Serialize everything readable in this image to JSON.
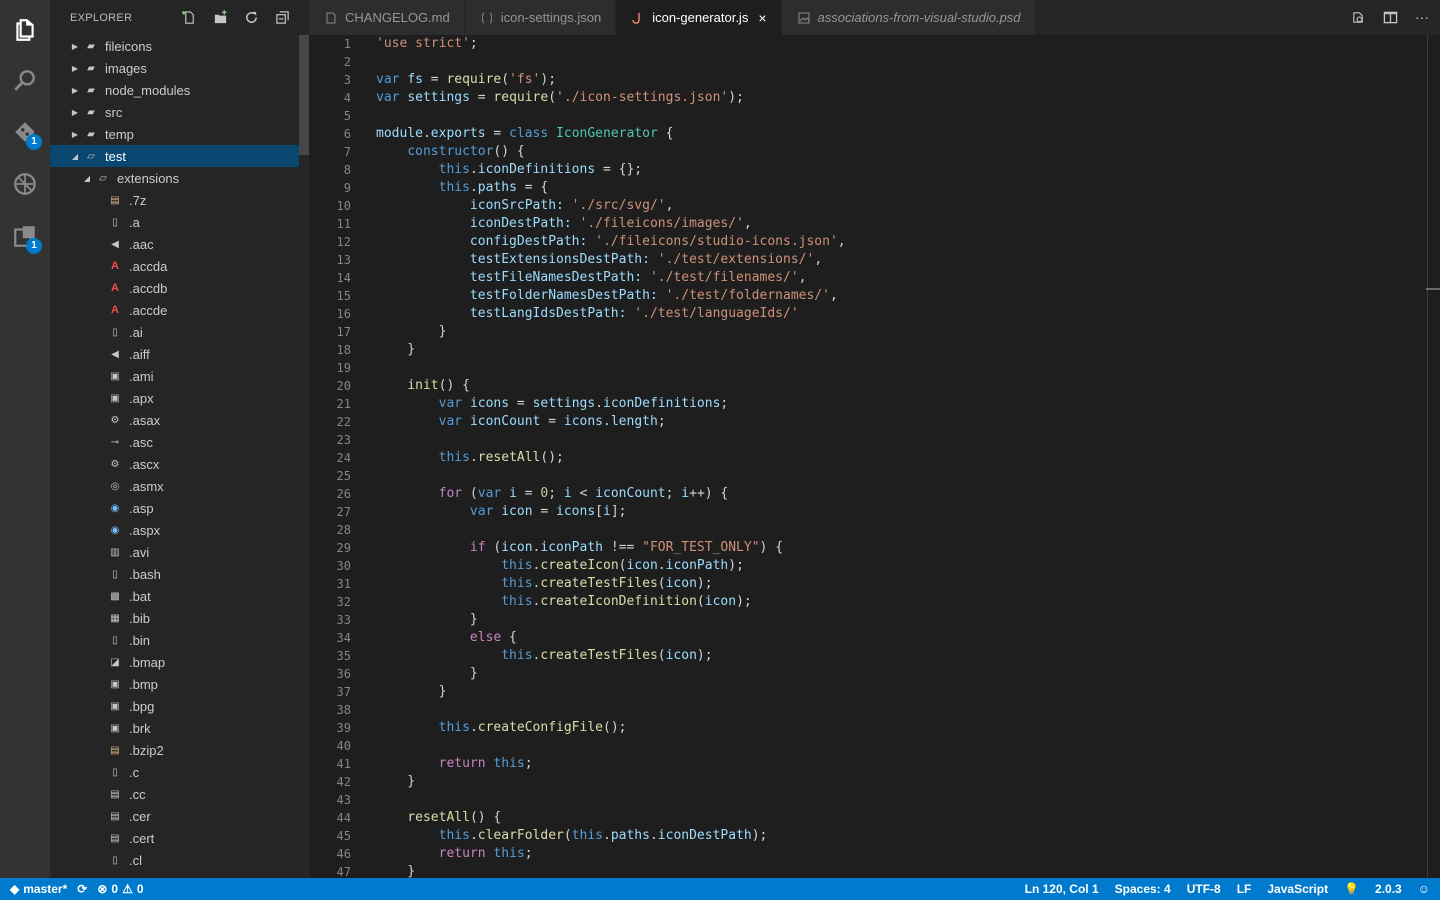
{
  "explorer": {
    "title": "EXPLORER",
    "tree": [
      {
        "label": "fileicons",
        "type": "folder",
        "depth": 0,
        "twisty": "closed",
        "icon": "folder-icon"
      },
      {
        "label": "images",
        "type": "folder",
        "depth": 0,
        "twisty": "closed",
        "icon": "folder-icon"
      },
      {
        "label": "node_modules",
        "type": "folder",
        "depth": 0,
        "twisty": "closed",
        "icon": "folder-icon"
      },
      {
        "label": "src",
        "type": "folder",
        "depth": 0,
        "twisty": "closed",
        "icon": "folder-icon"
      },
      {
        "label": "temp",
        "type": "folder",
        "depth": 0,
        "twisty": "closed",
        "icon": "folder-icon"
      },
      {
        "label": "test",
        "type": "folder",
        "depth": 0,
        "twisty": "open",
        "icon": "folder-open-icon",
        "selected": true
      },
      {
        "label": "extensions",
        "type": "folder",
        "depth": 1,
        "twisty": "open",
        "icon": "folder-open-icon"
      },
      {
        "label": ".7z",
        "depth": 2,
        "icon": "archive-icon"
      },
      {
        "label": ".a",
        "depth": 2,
        "icon": "file-icon"
      },
      {
        "label": ".aac",
        "depth": 2,
        "icon": "audio-icon"
      },
      {
        "label": ".accda",
        "depth": 2,
        "icon": "access-icon"
      },
      {
        "label": ".accdb",
        "depth": 2,
        "icon": "access-icon"
      },
      {
        "label": ".accde",
        "depth": 2,
        "icon": "access-icon"
      },
      {
        "label": ".ai",
        "depth": 2,
        "icon": "file-icon"
      },
      {
        "label": ".aiff",
        "depth": 2,
        "icon": "audio-icon"
      },
      {
        "label": ".ami",
        "depth": 2,
        "icon": "image-icon"
      },
      {
        "label": ".apx",
        "depth": 2,
        "icon": "image-icon"
      },
      {
        "label": ".asax",
        "depth": 2,
        "icon": "config-icon"
      },
      {
        "label": ".asc",
        "depth": 2,
        "icon": "key-icon"
      },
      {
        "label": ".ascx",
        "depth": 2,
        "icon": "web-control-icon"
      },
      {
        "label": ".asmx",
        "depth": 2,
        "icon": "web-service-icon"
      },
      {
        "label": ".asp",
        "depth": 2,
        "icon": "web-page-icon"
      },
      {
        "label": ".aspx",
        "depth": 2,
        "icon": "web-page-icon"
      },
      {
        "label": ".avi",
        "depth": 2,
        "icon": "video-icon"
      },
      {
        "label": ".bash",
        "depth": 2,
        "icon": "file-icon"
      },
      {
        "label": ".bat",
        "depth": 2,
        "icon": "terminal-icon"
      },
      {
        "label": ".bib",
        "depth": 2,
        "icon": "library-icon"
      },
      {
        "label": ".bin",
        "depth": 2,
        "icon": "file-icon"
      },
      {
        "label": ".bmap",
        "depth": 2,
        "icon": "bitmap-icon"
      },
      {
        "label": ".bmp",
        "depth": 2,
        "icon": "image-icon"
      },
      {
        "label": ".bpg",
        "depth": 2,
        "icon": "image-icon"
      },
      {
        "label": ".brk",
        "depth": 2,
        "icon": "image-icon"
      },
      {
        "label": ".bzip2",
        "depth": 2,
        "icon": "archive-icon"
      },
      {
        "label": ".c",
        "depth": 2,
        "icon": "file-icon"
      },
      {
        "label": ".cc",
        "depth": 2,
        "icon": "code-file-icon"
      },
      {
        "label": ".cer",
        "depth": 2,
        "icon": "certificate-icon"
      },
      {
        "label": ".cert",
        "depth": 2,
        "icon": "certificate-icon"
      },
      {
        "label": ".cl",
        "depth": 2,
        "icon": "file-icon"
      }
    ]
  },
  "activity": {
    "scm_badge": "1",
    "extensions_badge": "1"
  },
  "tabs": [
    {
      "label": "CHANGELOG.md",
      "icon": "markdown-icon",
      "active": false,
      "italic": false
    },
    {
      "label": "icon-settings.json",
      "icon": "json-icon",
      "active": false,
      "italic": false
    },
    {
      "label": "icon-generator.js",
      "icon": "js-icon",
      "active": true,
      "italic": false,
      "close": "×"
    },
    {
      "label": "associations-from-visual-studio.psd",
      "icon": "image-icon",
      "active": false,
      "italic": true
    }
  ],
  "colors": {
    "keyword": "#569cd6",
    "control": "#c586c0",
    "string": "#ce9178",
    "variable": "#9cdcfe",
    "function": "#dcdcaa",
    "class": "#4ec9b0",
    "number": "#b5cea8",
    "text": "#d4d4d4",
    "accent": "#007acc"
  },
  "code_lines": [
    [
      [
        "s",
        "'use strict'"
      ],
      [
        "t",
        ";"
      ]
    ],
    [],
    [
      [
        "k",
        "var "
      ],
      [
        "v",
        "fs"
      ],
      [
        "t",
        " = "
      ],
      [
        "f",
        "require"
      ],
      [
        "t",
        "("
      ],
      [
        "s",
        "'fs'"
      ],
      [
        "t",
        ");"
      ]
    ],
    [
      [
        "k",
        "var "
      ],
      [
        "v",
        "settings"
      ],
      [
        "t",
        " = "
      ],
      [
        "f",
        "require"
      ],
      [
        "t",
        "("
      ],
      [
        "s",
        "'./icon-settings.json'"
      ],
      [
        "t",
        ");"
      ]
    ],
    [],
    [
      [
        "v",
        "module"
      ],
      [
        "t",
        "."
      ],
      [
        "v",
        "exports"
      ],
      [
        "t",
        " = "
      ],
      [
        "k",
        "class "
      ],
      [
        "c",
        "IconGenerator"
      ],
      [
        "t",
        " {"
      ]
    ],
    [
      [
        "t",
        "    "
      ],
      [
        "k",
        "constructor"
      ],
      [
        "t",
        "() {"
      ]
    ],
    [
      [
        "t",
        "        "
      ],
      [
        "k",
        "this"
      ],
      [
        "t",
        "."
      ],
      [
        "v",
        "iconDefinitions"
      ],
      [
        "t",
        " = {};"
      ]
    ],
    [
      [
        "t",
        "        "
      ],
      [
        "k",
        "this"
      ],
      [
        "t",
        "."
      ],
      [
        "v",
        "paths"
      ],
      [
        "t",
        " = {"
      ]
    ],
    [
      [
        "t",
        "            "
      ],
      [
        "v",
        "iconSrcPath"
      ],
      [
        "v",
        ": "
      ],
      [
        "s",
        "'./src/svg/'"
      ],
      [
        "t",
        ","
      ]
    ],
    [
      [
        "t",
        "            "
      ],
      [
        "v",
        "iconDestPath"
      ],
      [
        "v",
        ": "
      ],
      [
        "s",
        "'./fileicons/images/'"
      ],
      [
        "t",
        ","
      ]
    ],
    [
      [
        "t",
        "            "
      ],
      [
        "v",
        "configDestPath"
      ],
      [
        "v",
        ": "
      ],
      [
        "s",
        "'./fileicons/studio-icons.json'"
      ],
      [
        "t",
        ","
      ]
    ],
    [
      [
        "t",
        "            "
      ],
      [
        "v",
        "testExtensionsDestPath"
      ],
      [
        "v",
        ": "
      ],
      [
        "s",
        "'./test/extensions/'"
      ],
      [
        "t",
        ","
      ]
    ],
    [
      [
        "t",
        "            "
      ],
      [
        "v",
        "testFileNamesDestPath"
      ],
      [
        "v",
        ": "
      ],
      [
        "s",
        "'./test/filenames/'"
      ],
      [
        "t",
        ","
      ]
    ],
    [
      [
        "t",
        "            "
      ],
      [
        "v",
        "testFolderNamesDestPath"
      ],
      [
        "v",
        ": "
      ],
      [
        "s",
        "'./test/foldernames/'"
      ],
      [
        "t",
        ","
      ]
    ],
    [
      [
        "t",
        "            "
      ],
      [
        "v",
        "testLangIdsDestPath"
      ],
      [
        "v",
        ": "
      ],
      [
        "s",
        "'./test/languageIds/'"
      ]
    ],
    [
      [
        "t",
        "        }"
      ]
    ],
    [
      [
        "t",
        "    }"
      ]
    ],
    [],
    [
      [
        "t",
        "    "
      ],
      [
        "f",
        "init"
      ],
      [
        "t",
        "() {"
      ]
    ],
    [
      [
        "t",
        "        "
      ],
      [
        "k",
        "var "
      ],
      [
        "v",
        "icons"
      ],
      [
        "t",
        " = "
      ],
      [
        "v",
        "settings"
      ],
      [
        "t",
        "."
      ],
      [
        "v",
        "iconDefinitions"
      ],
      [
        "t",
        ";"
      ]
    ],
    [
      [
        "t",
        "        "
      ],
      [
        "k",
        "var "
      ],
      [
        "v",
        "iconCount"
      ],
      [
        "t",
        " = "
      ],
      [
        "v",
        "icons"
      ],
      [
        "t",
        "."
      ],
      [
        "v",
        "length"
      ],
      [
        "t",
        ";"
      ]
    ],
    [],
    [
      [
        "t",
        "        "
      ],
      [
        "k",
        "this"
      ],
      [
        "t",
        "."
      ],
      [
        "f",
        "resetAll"
      ],
      [
        "t",
        "();"
      ]
    ],
    [],
    [
      [
        "t",
        "        "
      ],
      [
        "x",
        "for"
      ],
      [
        "t",
        " ("
      ],
      [
        "k",
        "var "
      ],
      [
        "v",
        "i"
      ],
      [
        "t",
        " = "
      ],
      [
        "n",
        "0"
      ],
      [
        "t",
        "; "
      ],
      [
        "v",
        "i"
      ],
      [
        "t",
        " < "
      ],
      [
        "v",
        "iconCount"
      ],
      [
        "t",
        "; "
      ],
      [
        "v",
        "i"
      ],
      [
        "t",
        "++) {"
      ]
    ],
    [
      [
        "t",
        "            "
      ],
      [
        "k",
        "var "
      ],
      [
        "v",
        "icon"
      ],
      [
        "t",
        " = "
      ],
      [
        "v",
        "icons"
      ],
      [
        "t",
        "["
      ],
      [
        "v",
        "i"
      ],
      [
        "t",
        "];"
      ]
    ],
    [],
    [
      [
        "t",
        "            "
      ],
      [
        "x",
        "if"
      ],
      [
        "t",
        " ("
      ],
      [
        "v",
        "icon"
      ],
      [
        "t",
        "."
      ],
      [
        "v",
        "iconPath"
      ],
      [
        "t",
        " !== "
      ],
      [
        "s",
        "\"FOR_TEST_ONLY\""
      ],
      [
        "t",
        ") {"
      ]
    ],
    [
      [
        "t",
        "                "
      ],
      [
        "k",
        "this"
      ],
      [
        "t",
        "."
      ],
      [
        "f",
        "createIcon"
      ],
      [
        "t",
        "("
      ],
      [
        "v",
        "icon"
      ],
      [
        "t",
        "."
      ],
      [
        "v",
        "iconPath"
      ],
      [
        "t",
        ");"
      ]
    ],
    [
      [
        "t",
        "                "
      ],
      [
        "k",
        "this"
      ],
      [
        "t",
        "."
      ],
      [
        "f",
        "createTestFiles"
      ],
      [
        "t",
        "("
      ],
      [
        "v",
        "icon"
      ],
      [
        "t",
        ");"
      ]
    ],
    [
      [
        "t",
        "                "
      ],
      [
        "k",
        "this"
      ],
      [
        "t",
        "."
      ],
      [
        "f",
        "createIconDefinition"
      ],
      [
        "t",
        "("
      ],
      [
        "v",
        "icon"
      ],
      [
        "t",
        ");"
      ]
    ],
    [
      [
        "t",
        "            }"
      ]
    ],
    [
      [
        "t",
        "            "
      ],
      [
        "x",
        "else"
      ],
      [
        "t",
        " {"
      ]
    ],
    [
      [
        "t",
        "                "
      ],
      [
        "k",
        "this"
      ],
      [
        "t",
        "."
      ],
      [
        "f",
        "createTestFiles"
      ],
      [
        "t",
        "("
      ],
      [
        "v",
        "icon"
      ],
      [
        "t",
        ");"
      ]
    ],
    [
      [
        "t",
        "            }"
      ]
    ],
    [
      [
        "t",
        "        }"
      ]
    ],
    [],
    [
      [
        "t",
        "        "
      ],
      [
        "k",
        "this"
      ],
      [
        "t",
        "."
      ],
      [
        "f",
        "createConfigFile"
      ],
      [
        "t",
        "();"
      ]
    ],
    [],
    [
      [
        "t",
        "        "
      ],
      [
        "x",
        "return "
      ],
      [
        "k",
        "this"
      ],
      [
        "t",
        ";"
      ]
    ],
    [
      [
        "t",
        "    }"
      ]
    ],
    [],
    [
      [
        "t",
        "    "
      ],
      [
        "f",
        "resetAll"
      ],
      [
        "t",
        "() {"
      ]
    ],
    [
      [
        "t",
        "        "
      ],
      [
        "k",
        "this"
      ],
      [
        "t",
        "."
      ],
      [
        "f",
        "clearFolder"
      ],
      [
        "t",
        "("
      ],
      [
        "k",
        "this"
      ],
      [
        "t",
        "."
      ],
      [
        "v",
        "paths"
      ],
      [
        "t",
        "."
      ],
      [
        "v",
        "iconDestPath"
      ],
      [
        "t",
        ");"
      ]
    ],
    [
      [
        "t",
        "        "
      ],
      [
        "x",
        "return "
      ],
      [
        "k",
        "this"
      ],
      [
        "t",
        ";"
      ]
    ],
    [
      [
        "t",
        "    }"
      ]
    ]
  ],
  "status": {
    "branch": "master*",
    "errors": "0",
    "warnings": "0",
    "position": "Ln 120, Col 1",
    "spaces": "Spaces: 4",
    "encoding": "UTF-8",
    "eol": "LF",
    "language": "JavaScript",
    "version": "2.0.3"
  }
}
